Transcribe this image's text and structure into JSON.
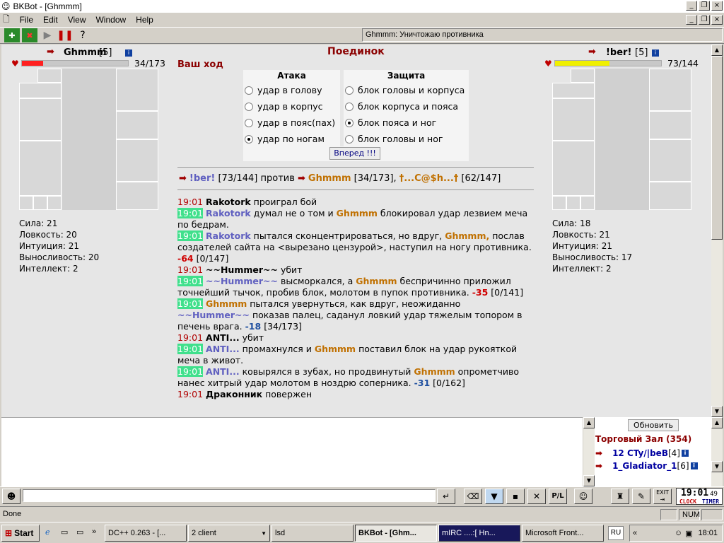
{
  "window": {
    "title": "BKBot - [Ghmmm]"
  },
  "menu": [
    "File",
    "Edit",
    "View",
    "Window",
    "Help"
  ],
  "status_line": "Ghmmm: Уничтожаю противника",
  "battle": {
    "title": "Поединок",
    "your_turn": "Ваш ход",
    "attack_header": "Атака",
    "defense_header": "Защита",
    "attacks": [
      "удар в голову",
      "удар в корпус",
      "удар в пояс(пах)",
      "удар по ногам"
    ],
    "attack_selected": 3,
    "defenses": [
      "блок головы и корпуса",
      "блок корпуса и пояса",
      "блок пояса и ног",
      "блок головы и ног"
    ],
    "defense_selected": 2,
    "forward_button": "Вперед !!!",
    "vs_line": {
      "a_name": "!ber!",
      "a_hp": "[73/144]",
      "against": "против",
      "b_name": "Ghmmm",
      "b_hp": "[34/173],",
      "c_name": "†...C@$h...†",
      "c_hp": "[62/147]"
    }
  },
  "left_player": {
    "name": "Ghmmm",
    "level": "[5]",
    "hp_text": "34/173",
    "hp_fraction": 0.2,
    "hp_color": "#ff2020",
    "stats": [
      "Сила: 21",
      "Ловкость: 20",
      "Интуиция: 21",
      "Выносливость: 20",
      "Интеллект: 2"
    ]
  },
  "right_player": {
    "name": "!ber!",
    "level": "[5]",
    "hp_text": "73/144",
    "hp_fraction": 0.51,
    "hp_color": "#f0f000",
    "stats": [
      "Сила: 18",
      "Ловкость: 21",
      "Интуиция: 21",
      "Выносливость: 17",
      "Интеллект: 2"
    ]
  },
  "log": [
    {
      "time": "19:01",
      "hl": false,
      "parts": [
        [
          "nb",
          "Rakotork"
        ],
        [
          "",
          "проиграл бой"
        ]
      ]
    },
    {
      "time": "19:01",
      "hl": true,
      "parts": [
        [
          "n1",
          "Rakotork"
        ],
        [
          "",
          "думал не о том и"
        ],
        [
          "n2",
          "Ghmmm"
        ],
        [
          "",
          "блокировал удар лезвием меча по бедрам."
        ]
      ]
    },
    {
      "time": "19:01",
      "hl": true,
      "parts": [
        [
          "n1",
          "Rakotork"
        ],
        [
          "",
          "пытался сконцентрироваться, но вдруг,"
        ],
        [
          "n2",
          "Ghmmm,"
        ],
        [
          "",
          "послав создателей сайта на <вырезано цензурой>, наступил на ногу противника."
        ],
        [
          "dmg",
          "-64"
        ],
        [
          "",
          "[0/147]"
        ]
      ]
    },
    {
      "time": "19:01",
      "hl": false,
      "parts": [
        [
          "nb",
          "~~Hummer~~"
        ],
        [
          "",
          "убит"
        ]
      ]
    },
    {
      "time": "19:01",
      "hl": true,
      "parts": [
        [
          "n1",
          "~~Hummer~~"
        ],
        [
          "",
          "высморкался, а"
        ],
        [
          "n2",
          "Ghmmm"
        ],
        [
          "",
          "беспричинно приложил точнейший тычок, пробив блок, молотом в пупок противника."
        ],
        [
          "dmg",
          "-35"
        ],
        [
          "",
          "[0/141]"
        ]
      ]
    },
    {
      "time": "19:01",
      "hl": true,
      "parts": [
        [
          "n2",
          "Ghmmm"
        ],
        [
          "",
          "пытался увернуться, как вдруг, неожиданно"
        ],
        [
          "n1",
          "~~Hummer~~"
        ],
        [
          "",
          "показав палец, саданул ловкий удар тяжелым топором в печень врага."
        ],
        [
          "dmgb",
          "-18"
        ],
        [
          "",
          "[34/173]"
        ]
      ]
    },
    {
      "time": "19:01",
      "hl": false,
      "parts": [
        [
          "nb",
          "ANTI..."
        ],
        [
          "",
          "убит"
        ]
      ]
    },
    {
      "time": "19:01",
      "hl": true,
      "parts": [
        [
          "n1",
          "ANTI..."
        ],
        [
          "",
          "промахнулся и"
        ],
        [
          "n2",
          "Ghmmm"
        ],
        [
          "",
          "поставил блок на удар рукояткой меча в живот."
        ]
      ]
    },
    {
      "time": "19:01",
      "hl": true,
      "parts": [
        [
          "n1",
          "ANTI..."
        ],
        [
          "",
          "ковырялся в зубах, но продвинутый"
        ],
        [
          "n2",
          "Ghmmm"
        ],
        [
          "",
          "опрометчиво нанес хитрый удар молотом в ноздрю соперника."
        ],
        [
          "dmgb",
          "-31"
        ],
        [
          "",
          "[0/162]"
        ]
      ]
    },
    {
      "time": "19:01",
      "hl": false,
      "parts": [
        [
          "nb",
          "Драконник"
        ],
        [
          "",
          "повержен"
        ]
      ]
    }
  ],
  "chat": {
    "refresh": "Обновить",
    "room": "Торговый Зал (354)",
    "users": [
      {
        "name": "12 CTy/|beB",
        "lvl": "[4]"
      },
      {
        "name": "1_Gladiator_1",
        "lvl": "[6]"
      }
    ]
  },
  "clock": {
    "time": "19:01",
    "sec": "49",
    "clock_label": "CLOCK",
    "timer_label": "TIMER"
  },
  "exit_label": "EXIT",
  "statusbar": {
    "text": "Done",
    "num": "NUM"
  },
  "taskbar": {
    "start": "Start",
    "tasks": [
      "DC++ 0.263 - [...",
      "2 client",
      "lsd",
      "BKBot - [Ghm...",
      "mIRC ....:[ Hn...",
      "Microsoft Front..."
    ],
    "lang": "RU",
    "time": "18:01"
  }
}
